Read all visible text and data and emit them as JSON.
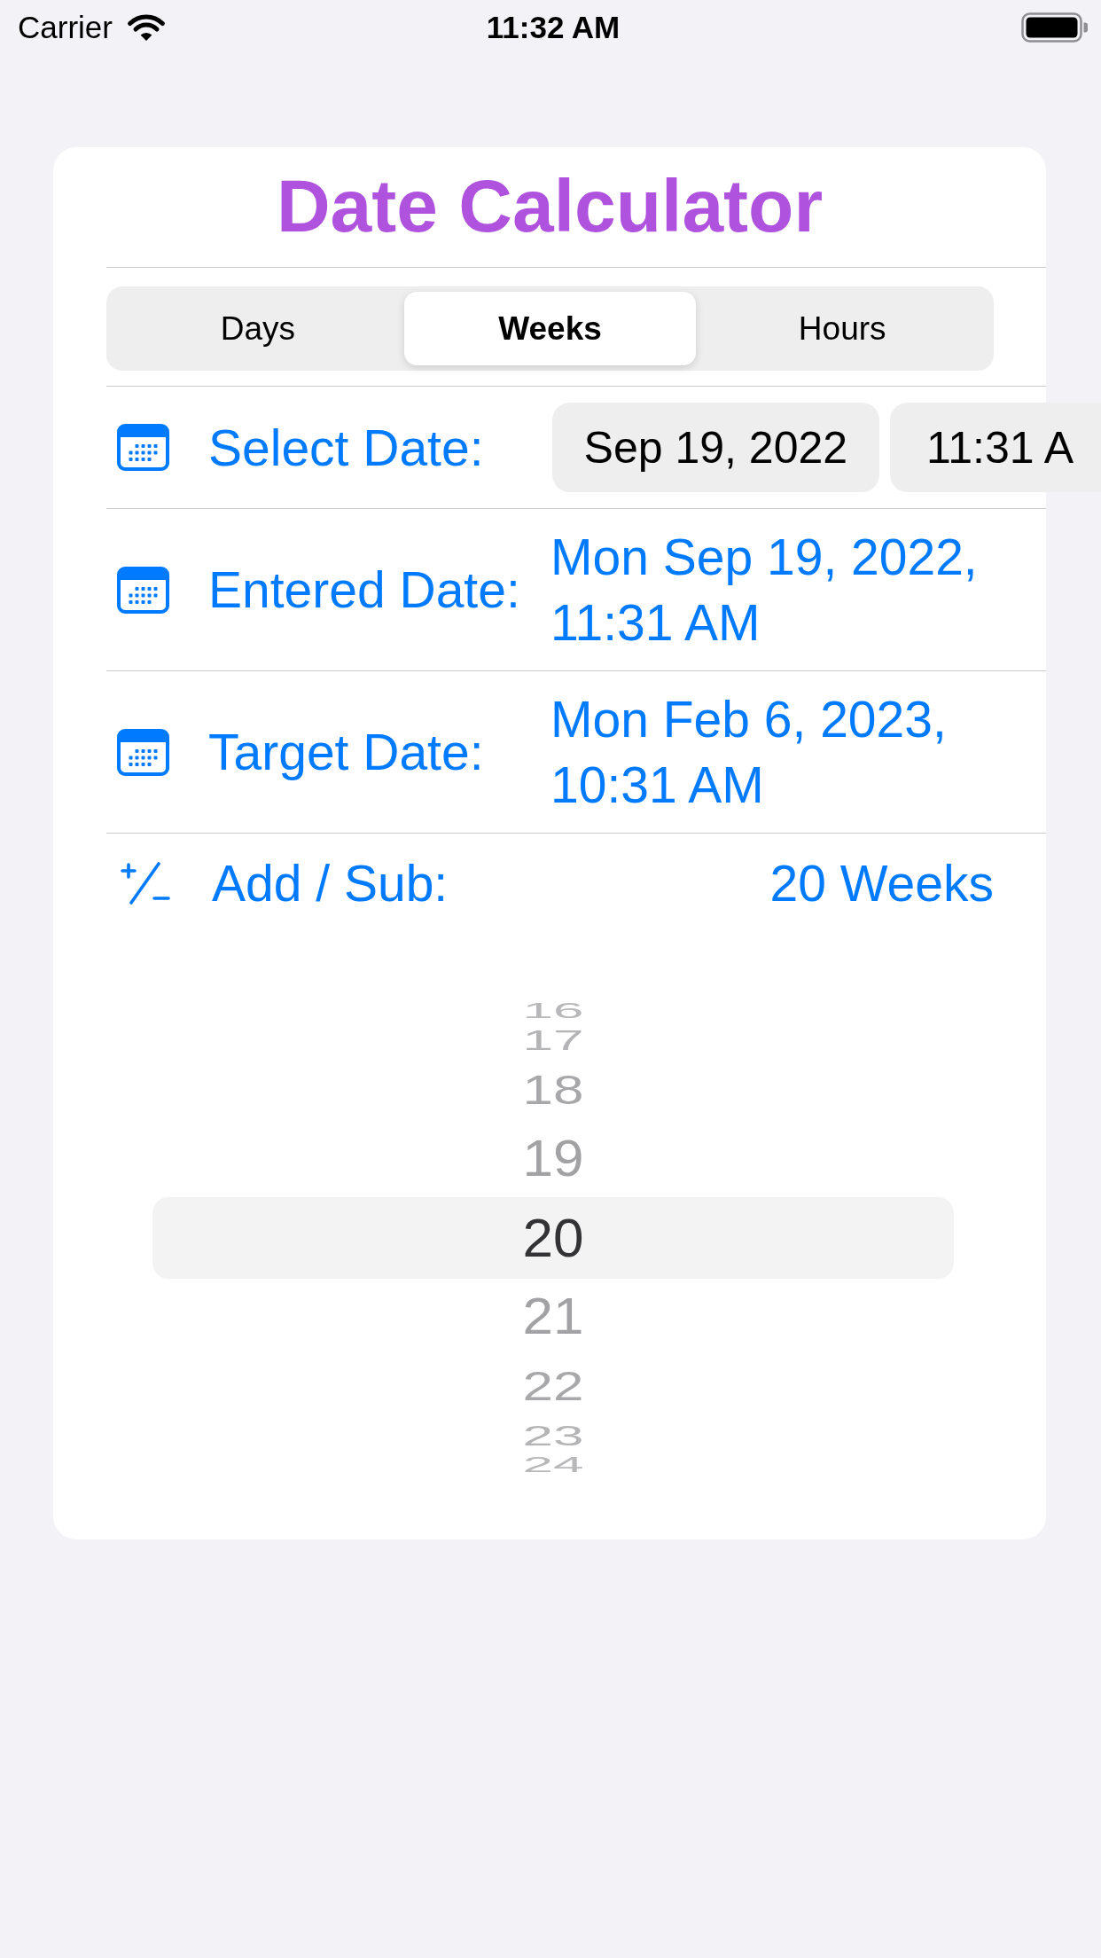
{
  "status_bar": {
    "carrier": "Carrier",
    "time": "11:32 AM"
  },
  "title": "Date Calculator",
  "tabs": [
    {
      "label": "Days",
      "selected": false
    },
    {
      "label": "Weeks",
      "selected": true
    },
    {
      "label": "Hours",
      "selected": false
    }
  ],
  "rows": [
    {
      "kind": "date_picker",
      "label": "Select Date:",
      "date": "Sep 19, 2022",
      "time": "11:31 A"
    },
    {
      "kind": "value",
      "label": "Entered Date:",
      "value": "Mon Sep 19, 2022, 11:31 AM"
    },
    {
      "kind": "value",
      "label": "Target Date:",
      "value": "Mon Feb 6, 2023, 10:31 AM"
    },
    {
      "kind": "amount",
      "label": "Add / Sub:",
      "value": "20 Weeks"
    }
  ],
  "wheel": {
    "items": [
      {
        "label": "16",
        "selected": false
      },
      {
        "label": "17",
        "selected": false
      },
      {
        "label": "18",
        "selected": false
      },
      {
        "label": "19",
        "selected": false
      },
      {
        "label": "20",
        "selected": true
      },
      {
        "label": "21",
        "selected": false
      },
      {
        "label": "22",
        "selected": false
      },
      {
        "label": "23",
        "selected": false
      },
      {
        "label": "24",
        "selected": false
      }
    ]
  }
}
